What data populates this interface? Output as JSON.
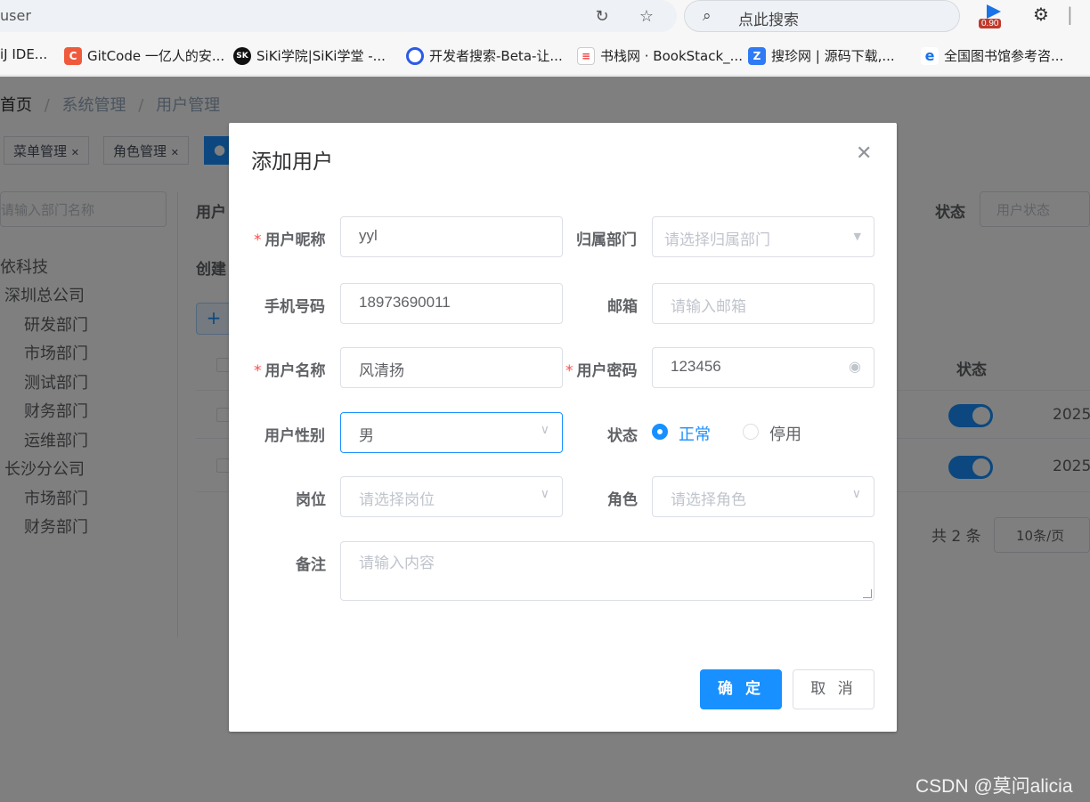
{
  "browser": {
    "url_fragment": "user",
    "search_placeholder": "点此搜索",
    "badge": "0.90",
    "bookmarks": [
      {
        "label": "iJ IDE...",
        "icon": "intellij-icon"
      },
      {
        "label": "GitCode 一亿人的安...",
        "icon": "gitcode-icon"
      },
      {
        "label": "SiKi学院|SiKi学堂 -...",
        "icon": "siki-icon"
      },
      {
        "label": "开发者搜索-Beta-让...",
        "icon": "dev-search-icon"
      },
      {
        "label": "书栈网 · BookStack_...",
        "icon": "bookstack-icon"
      },
      {
        "label": "搜珍网 | 源码下载,...",
        "icon": "souzhen-icon"
      },
      {
        "label": "全国图书馆参考咨...",
        "icon": "ie-icon"
      }
    ]
  },
  "background": {
    "breadcrumb": {
      "home": "首页",
      "sep": "/",
      "sys": "系统管理",
      "user": "用户管理"
    },
    "tags": [
      "菜单管理",
      "角色管理"
    ],
    "dept_search_placeholder": "请输入部门名称",
    "tree": [
      "依科技",
      "深圳总公司",
      "研发部门",
      "市场部门",
      "测试部门",
      "财务部门",
      "运维部门",
      "长沙分公司",
      "市场部门",
      "财务部门"
    ],
    "label_user": "用户",
    "label_created": "创建",
    "label_status": "状态",
    "status_placeholder": "用户状态",
    "col_status": "状态",
    "row_dates": [
      "2025-",
      "2025-"
    ],
    "pagination_total": "共 2 条",
    "page_size": "10条/页"
  },
  "dialog": {
    "title": "添加用户",
    "fields": {
      "nickname": {
        "label": "用户昵称",
        "value": "yyl",
        "required": true
      },
      "dept": {
        "label": "归属部门",
        "placeholder": "请选择归属部门"
      },
      "phone": {
        "label": "手机号码",
        "value": "18973690011"
      },
      "email": {
        "label": "邮箱",
        "placeholder": "请输入邮箱"
      },
      "username": {
        "label": "用户名称",
        "value": "风清扬",
        "required": true
      },
      "password": {
        "label": "用户密码",
        "value": "123456",
        "required": true
      },
      "gender": {
        "label": "用户性别",
        "value": "男"
      },
      "status": {
        "label": "状态",
        "options": [
          "正常",
          "停用"
        ],
        "selected": "正常"
      },
      "post": {
        "label": "岗位",
        "placeholder": "请选择岗位"
      },
      "role": {
        "label": "角色",
        "placeholder": "请选择角色"
      },
      "remark": {
        "label": "备注",
        "placeholder": "请输入内容"
      }
    },
    "confirm_label": "确 定",
    "cancel_label": "取 消"
  },
  "watermark": "CSDN @莫问alicia",
  "colors": {
    "primary": "#1890ff",
    "required": "#ff4949"
  }
}
